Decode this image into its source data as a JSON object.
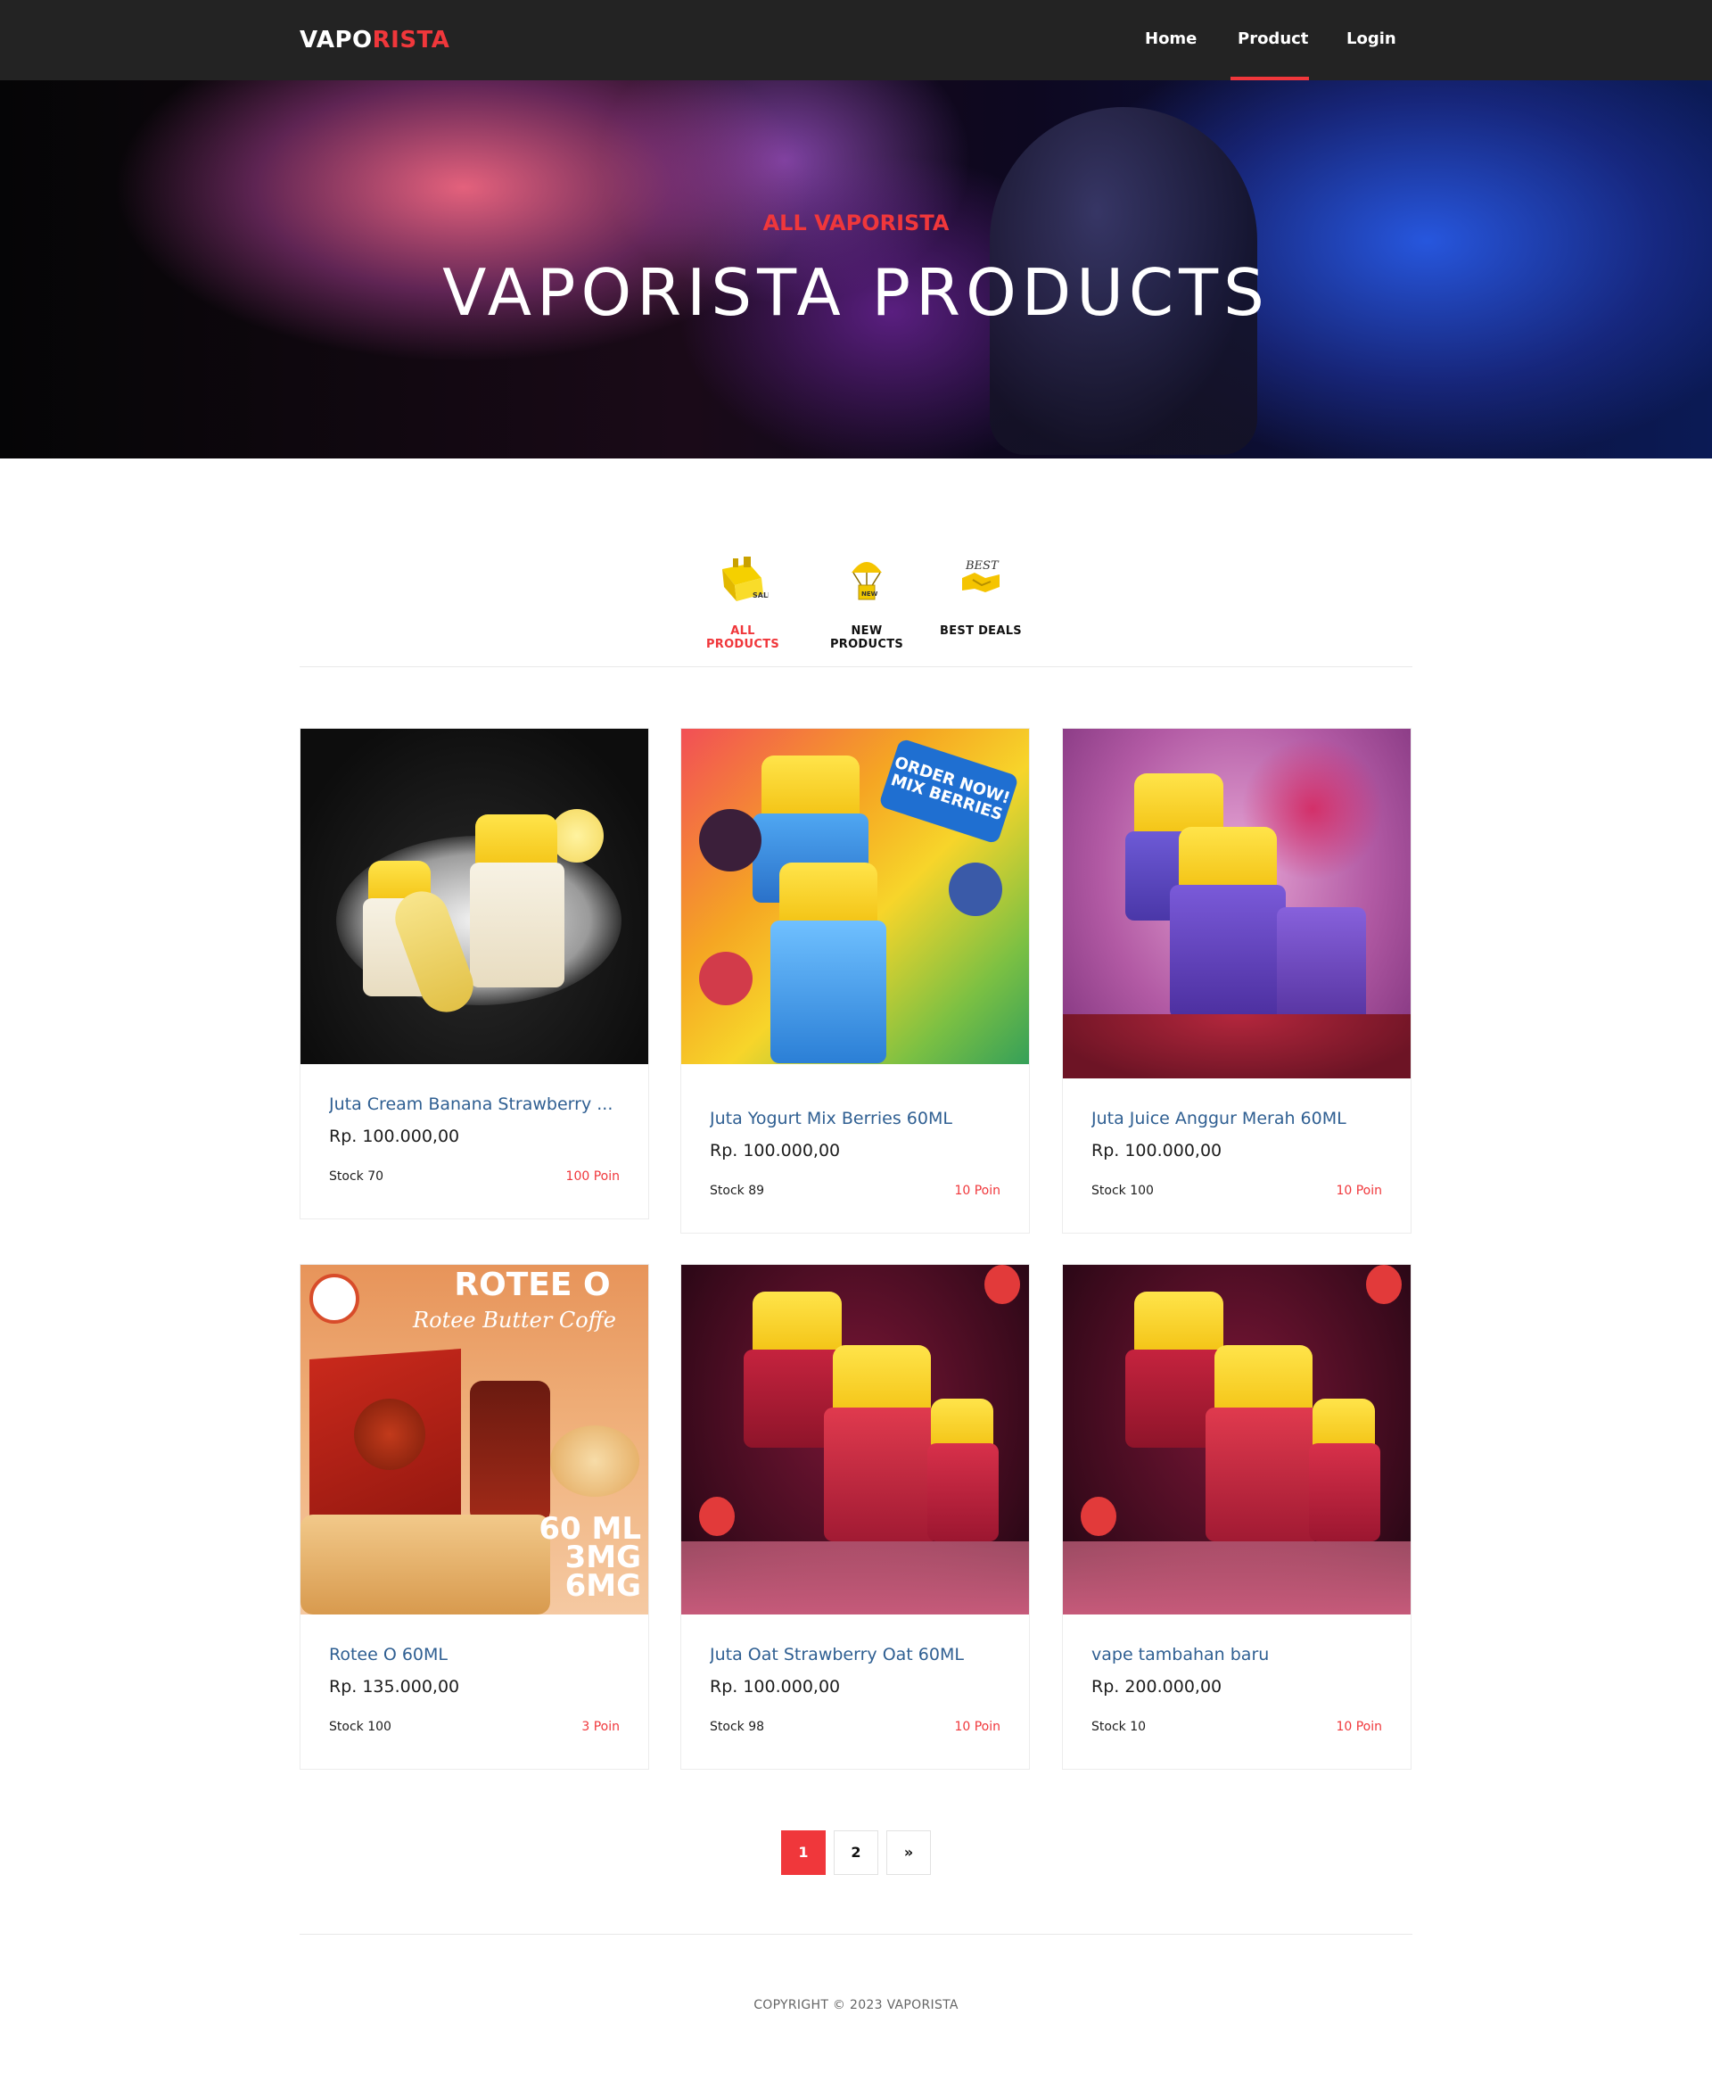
{
  "brand": {
    "part1": "VAPO",
    "part2": "RISTA",
    "accent_color": "#f0373b"
  },
  "nav": {
    "home": "Home",
    "product": "Product",
    "login": "Login"
  },
  "hero": {
    "subtitle": "ALL VAPORISTA",
    "title": "VAPORISTA PRODUCTS"
  },
  "tabs": [
    {
      "label": "ALL PRODUCTS",
      "icon": "sale-box-icon",
      "active": true
    },
    {
      "label": "NEW PRODUCTS",
      "icon": "parachute-box-icon",
      "active": false
    },
    {
      "label": "BEST DEALS",
      "icon": "best-deal-handshake-icon",
      "active": false
    }
  ],
  "products": [
    {
      "name": "Juta Cream Banana Strawberry ...",
      "price": "Rp. 100.000,00",
      "stock": "Stock 70",
      "poin": "100 Poin",
      "image": "juta-cream-banana-image"
    },
    {
      "name": "Juta Yogurt Mix Berries 60ML",
      "price": "Rp. 100.000,00",
      "stock": "Stock 89",
      "poin": "10 Poin",
      "image": "juta-yogurt-mix-berries-image",
      "image_text": "ORDER NOW! MIX BERRIES"
    },
    {
      "name": "Juta Juice Anggur Merah 60ML",
      "price": "Rp. 100.000,00",
      "stock": "Stock 100",
      "poin": "10 Poin",
      "image": "juta-juice-anggur-merah-image"
    },
    {
      "name": "Rotee O 60ML",
      "price": "Rp. 135.000,00",
      "stock": "Stock 100",
      "poin": "3 Poin",
      "image": "rotee-o-image",
      "image_text": {
        "title": "ROTEE O",
        "subtitle": "Rotee Butter Coffe",
        "volume": "60 ML",
        "mg1": "3MG",
        "mg2": "6MG"
      }
    },
    {
      "name": "Juta Oat Strawberry Oat 60ML",
      "price": "Rp. 100.000,00",
      "stock": "Stock 98",
      "poin": "10 Poin",
      "image": "juta-oats-strawberry-image"
    },
    {
      "name": "vape tambahan baru",
      "price": "Rp. 200.000,00",
      "stock": "Stock 10",
      "poin": "10 Poin",
      "image": "juta-oats-strawberry-image"
    }
  ],
  "pagination": {
    "page1": "1",
    "page2": "2",
    "next": "»"
  },
  "footer": {
    "copyright": "COPYRIGHT © 2023 VAPORISTA"
  }
}
